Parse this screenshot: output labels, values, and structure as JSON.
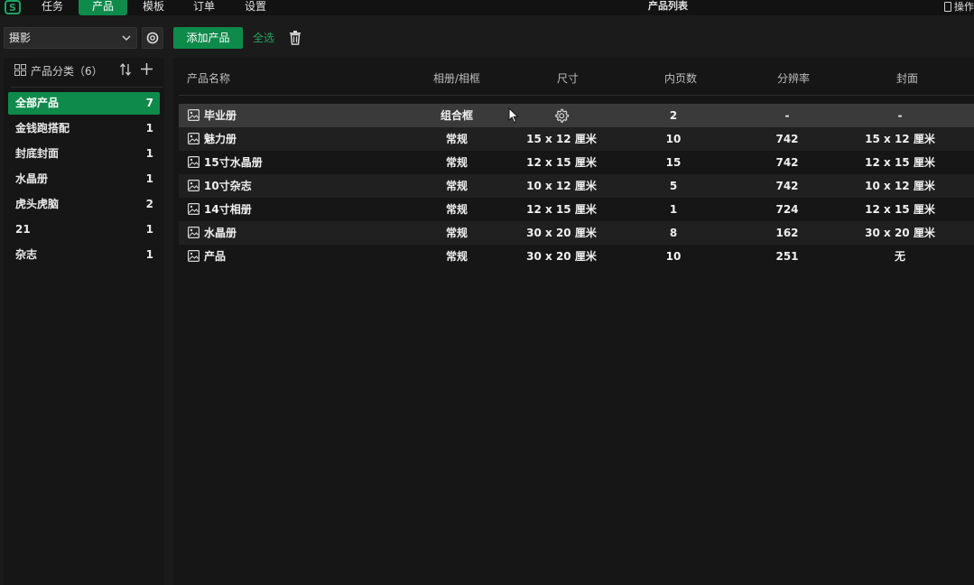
{
  "topbar": {
    "menu": [
      {
        "label": "任务"
      },
      {
        "label": "产品",
        "active": true
      },
      {
        "label": "模板"
      },
      {
        "label": "订单"
      },
      {
        "label": "设置"
      }
    ],
    "window_title": "产品列表",
    "ops_label": "操作"
  },
  "toolbar": {
    "category_value": "摄影",
    "add_label": "添加产品",
    "select_all_label": "全选"
  },
  "sidebar": {
    "title": "产品分类（6）",
    "items": [
      {
        "label": "全部产品",
        "count": "7",
        "active": true
      },
      {
        "label": "金钱跑搭配",
        "count": "1"
      },
      {
        "label": "封底封面",
        "count": "1"
      },
      {
        "label": "水晶册",
        "count": "1"
      },
      {
        "label": "虎头虎脑",
        "count": "2"
      },
      {
        "label": "21",
        "count": "1"
      },
      {
        "label": "杂志",
        "count": "1"
      }
    ]
  },
  "table": {
    "headers": {
      "name": "产品名称",
      "album": "相册/相框",
      "size": "尺寸",
      "pages": "内页数",
      "resolution": "分辨率",
      "cover": "封面"
    },
    "rows": [
      {
        "name": "毕业册",
        "album": "组合框",
        "size": "",
        "pages": "2",
        "resolution": "-",
        "cover": "-",
        "selected": true
      },
      {
        "name": "魅力册",
        "album": "常规",
        "size": "15 x 12 厘米",
        "pages": "10",
        "resolution": "742",
        "cover": "15 x 12 厘米"
      },
      {
        "name": "15寸水晶册",
        "album": "常规",
        "size": "12 x 15 厘米",
        "pages": "15",
        "resolution": "742",
        "cover": "12 x 15 厘米"
      },
      {
        "name": "10寸杂志",
        "album": "常规",
        "size": "10 x 12 厘米",
        "pages": "5",
        "resolution": "742",
        "cover": "10 x 12 厘米"
      },
      {
        "name": "14寸相册",
        "album": "常规",
        "size": "12 x 15 厘米",
        "pages": "1",
        "resolution": "724",
        "cover": "12 x 15 厘米"
      },
      {
        "name": "水晶册",
        "album": "常规",
        "size": "30 x 20 厘米",
        "pages": "8",
        "resolution": "162",
        "cover": "30 x 20 厘米"
      },
      {
        "name": "产品",
        "album": "常规",
        "size": "30 x 20 厘米",
        "pages": "10",
        "resolution": "251",
        "cover": "无"
      }
    ]
  },
  "colors": {
    "accent": "#0e8a4a",
    "accent_text": "#27a35e",
    "background": "#1b1b1b",
    "panel": "#161616"
  },
  "icons": [
    "app-logo-icon",
    "chevron-down-icon",
    "gear-icon",
    "trash-icon",
    "grid-icon",
    "sort-icon",
    "plus-icon",
    "image-icon",
    "cursor-icon",
    "panel-icon"
  ]
}
